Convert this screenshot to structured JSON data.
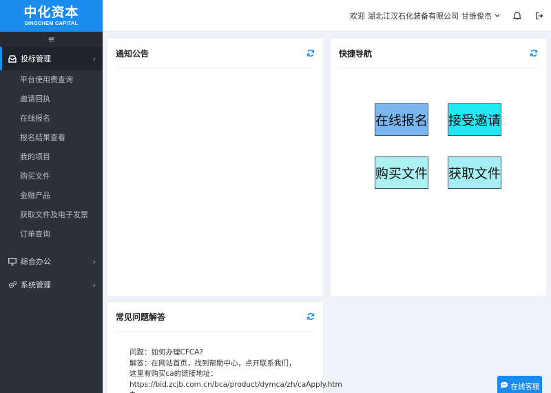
{
  "brand": {
    "cn": "中化资本",
    "en": "SINOCHEM CAPITAL"
  },
  "sidebar": {
    "toggle": "≡",
    "groups": [
      {
        "label": "投标管理",
        "icon": "inbox-icon",
        "expanded": true,
        "items": [
          {
            "label": "平台使用费查询"
          },
          {
            "label": "邀请回执"
          },
          {
            "label": "在线报名"
          },
          {
            "label": "报名结果查看"
          },
          {
            "label": "我的项目"
          },
          {
            "label": "购买文件"
          },
          {
            "label": "金融产品"
          },
          {
            "label": "获取文件及电子发票"
          },
          {
            "label": "订单查询"
          }
        ]
      },
      {
        "label": "综合办公",
        "icon": "monitor-icon",
        "expanded": false
      },
      {
        "label": "系统管理",
        "icon": "gears-icon",
        "expanded": false
      }
    ]
  },
  "header": {
    "welcome": "欢迎",
    "company": "湖北江汉石化装备有限公司",
    "user": "甘维俊杰"
  },
  "panels": {
    "notice": {
      "title": "通知公告"
    },
    "nav": {
      "title": "快捷导航",
      "buttons": [
        {
          "label": "在线报名",
          "color": "#7ab7f1"
        },
        {
          "label": "接受邀请",
          "color": "#23e7f2"
        },
        {
          "label": "购买文件",
          "color": "#abf1f4"
        },
        {
          "label": "获取文件",
          "color": "#a5eef3"
        }
      ]
    },
    "faq": {
      "title": "常见问题解答",
      "question": "问题：如何办理CFCA?",
      "answer": "解答：在网站首页，找到帮助中心，点开联系我们，这里有购买ca的链接地址：",
      "link": "https://bid.zcjb.com.cn/bca/product/dymca/zh/caApply.htm 办"
    }
  },
  "service": {
    "label": "在线客服"
  },
  "colors": {
    "brand": "#1a8cf0",
    "sidebar": "#2b3138"
  }
}
